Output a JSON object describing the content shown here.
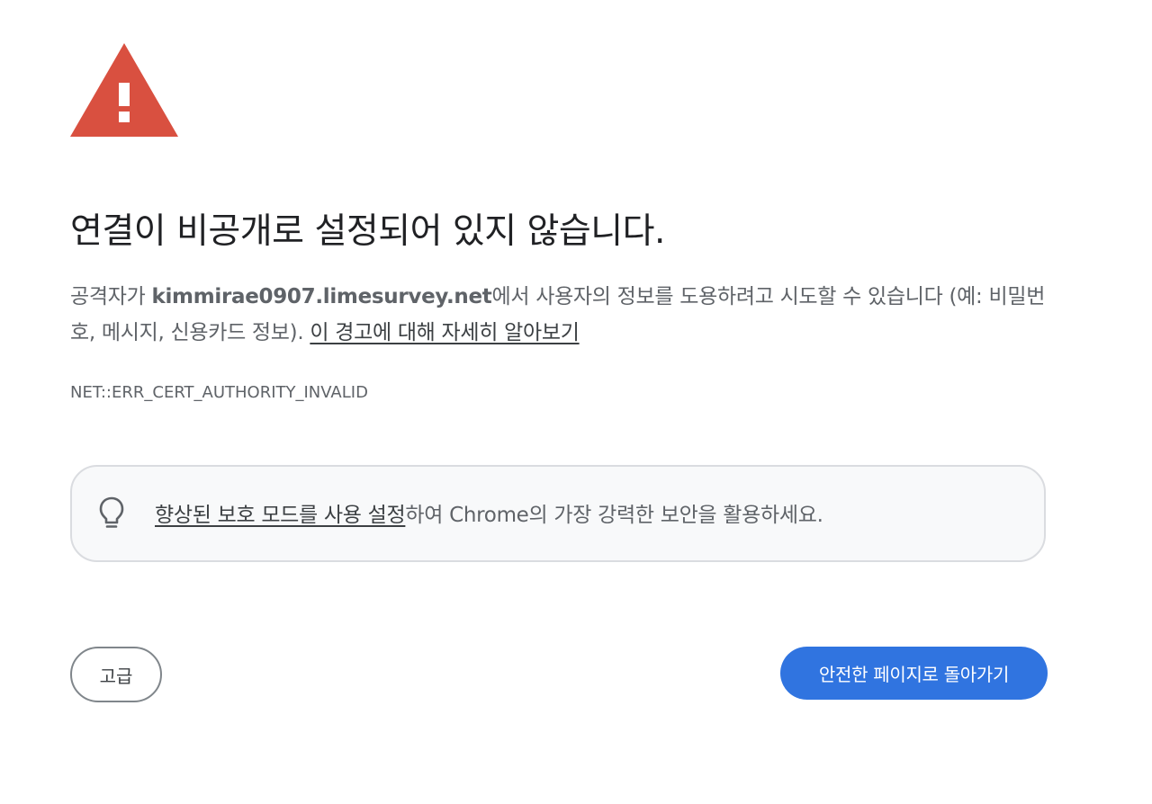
{
  "warning_icon": "warning-triangle-icon",
  "colors": {
    "warning_red": "#d95040",
    "primary_blue": "#3074e0",
    "box_background": "#f8f9fa",
    "box_border": "#dadce0"
  },
  "heading": "연결이 비공개로 설정되어 있지 않습니다.",
  "description": {
    "prefix": "공격자가 ",
    "host": "kimmirae0907.limesurvey.net",
    "suffix": "에서 사용자의 정보를 도용하려고 시도할 수 있습니다 (예: 비밀번호, 메시지, 신용카드 정보). ",
    "learn_more_link": "이 경고에 대해 자세히 알아보기"
  },
  "error_code": "NET::ERR_CERT_AUTHORITY_INVALID",
  "enhanced_protection": {
    "icon": "lightbulb-icon",
    "link": "향상된 보호 모드를 사용 설정",
    "text": "하여 Chrome의 가장 강력한 보안을 활용하세요."
  },
  "buttons": {
    "advanced": "고급",
    "back_to_safety": "안전한 페이지로 돌아가기"
  }
}
